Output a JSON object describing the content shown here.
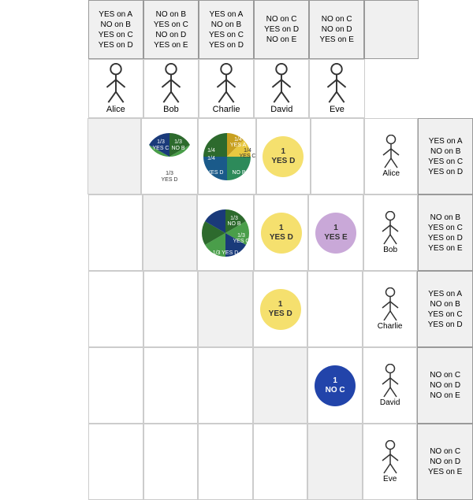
{
  "headers": {
    "col_labels": [
      "YES on A\nNO on B\nYES on C\nYES on D",
      "NO on B\nYES on C\nNO on D\nYES on E",
      "YES on A\nNO on B\nYES on C\nYES on D",
      "NO on C\nYES on D\nNO on E",
      "NO on C\nNO on D\nYES on E"
    ],
    "col_names": [
      "Alice",
      "Bob",
      "Charlie",
      "David",
      "Eve"
    ]
  },
  "right_labels": [
    "YES on A\nNO on B\nYES on C\nYES on D",
    "NO on B\nYES on C\nNO on D\nYES on E",
    "YES on A\nNO on B\nYES on C\nYES on D",
    "NO on C\nNO on D\nNO on E",
    "NO on C\nNO on D\nYES on E"
  ],
  "right_names": [
    "Alice",
    "Bob",
    "Charlie",
    "David",
    "Eve"
  ],
  "cells": {
    "alice_bob": "pie_abc",
    "alice_charlie": "pie_ac2",
    "alice_david": "1 YES D",
    "alice_eve": "",
    "bob_charlie": "pie_bc",
    "bob_david": "1 YES D",
    "bob_eve": "1 YES E",
    "charlie_david": "1 YES D",
    "charlie_eve": "",
    "david_eve": "1 NO C"
  }
}
